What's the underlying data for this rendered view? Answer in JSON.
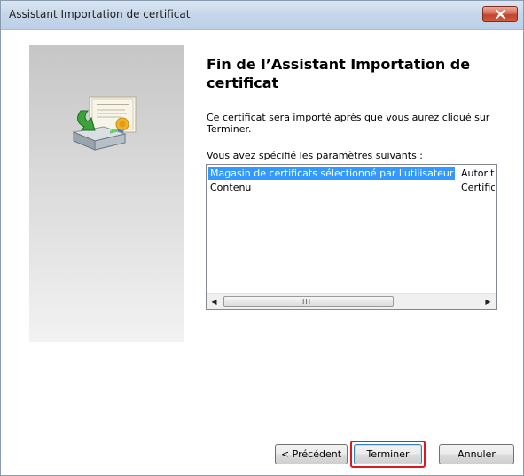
{
  "window": {
    "title": "Assistant Importation de certificat"
  },
  "page": {
    "heading": "Fin de l’Assistant Importation de certificat",
    "description": "Ce certificat sera importé après que vous aurez cliqué sur Terminer.",
    "list_label": "Vous avez spécifié les paramètres suivants :"
  },
  "settings_list": {
    "rows": [
      {
        "name": "Magasin de certificats sélectionné par l'utilisateur",
        "value": "Autorités",
        "selected": true
      },
      {
        "name": "Contenu",
        "value": "Certificat",
        "selected": false
      }
    ],
    "scroll_left_arrow": "◀",
    "scroll_right_arrow": "▶",
    "scroll_grip": "III"
  },
  "buttons": {
    "previous": "< Précédent",
    "finish": "Terminer",
    "cancel": "Annuler"
  },
  "colors": {
    "selection": "#3399ff",
    "highlight_border": "#e0171d",
    "close_button": "#c1432b"
  },
  "icons": {
    "close": "close-icon",
    "wizard": "certificate-import-icon"
  }
}
